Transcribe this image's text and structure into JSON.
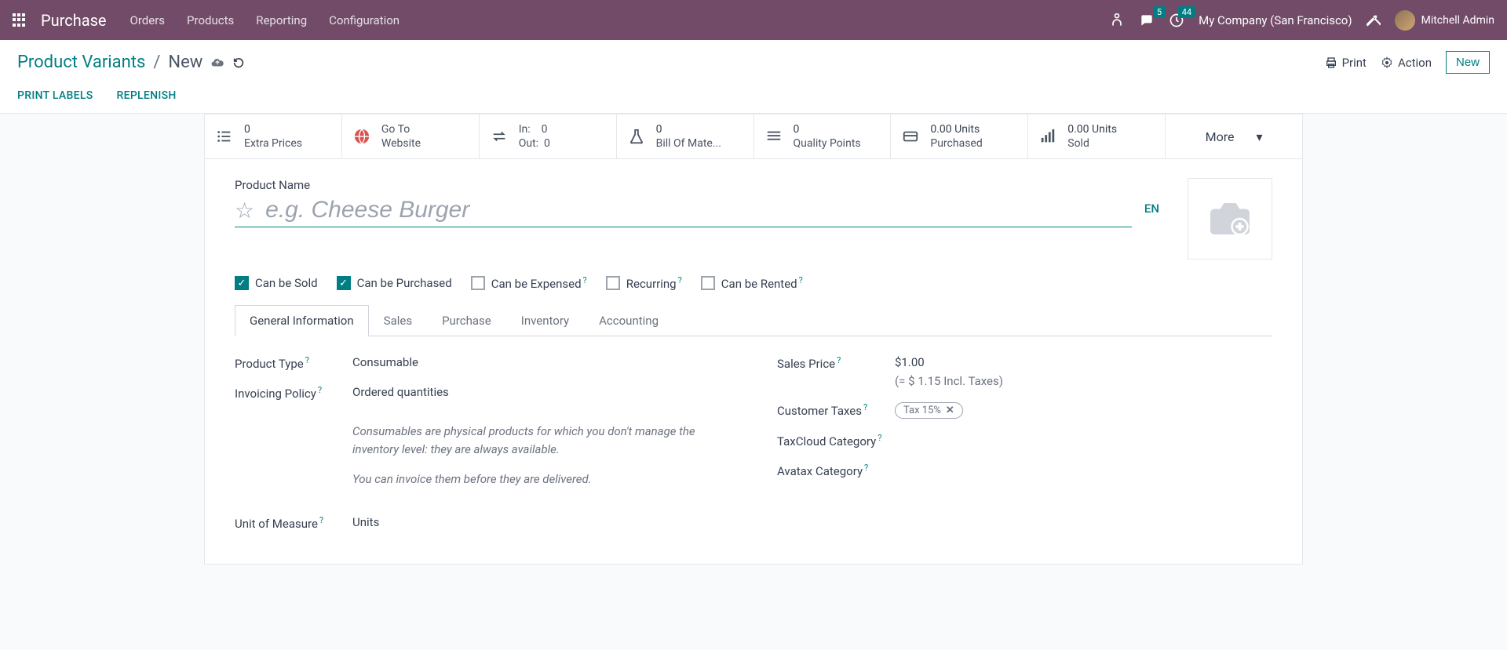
{
  "topbar": {
    "brand": "Purchase",
    "menu": [
      "Orders",
      "Products",
      "Reporting",
      "Configuration"
    ],
    "msg_count": "5",
    "activity_count": "44",
    "company": "My Company (San Francisco)",
    "user": "Mitchell Admin"
  },
  "breadcrumb": {
    "parent": "Product Variants",
    "current": "New"
  },
  "actions": {
    "print": "Print",
    "action": "Action",
    "new": "New"
  },
  "secondary": {
    "print_labels": "PRINT LABELS",
    "replenish": "REPLENISH"
  },
  "stats": {
    "extra_prices": {
      "val": "0",
      "label": "Extra Prices"
    },
    "website": {
      "line1": "Go To",
      "line2": "Website"
    },
    "inout": {
      "in_label": "In:",
      "in_val": "0",
      "out_label": "Out:",
      "out_val": "0"
    },
    "bom": {
      "val": "0",
      "label": "Bill Of Mate..."
    },
    "quality": {
      "val": "0",
      "label": "Quality Points"
    },
    "purchased": {
      "val": "0.00 Units",
      "label": "Purchased"
    },
    "sold": {
      "val": "0.00 Units",
      "label": "Sold"
    },
    "more": "More"
  },
  "product": {
    "name_label": "Product Name",
    "name_placeholder": "e.g. Cheese Burger",
    "name_value": "",
    "lang": "EN"
  },
  "checks": {
    "sold": "Can be Sold",
    "purchased": "Can be Purchased",
    "expensed": "Can be Expensed",
    "recurring": "Recurring",
    "rented": "Can be Rented"
  },
  "tabs": [
    "General Information",
    "Sales",
    "Purchase",
    "Inventory",
    "Accounting"
  ],
  "fields": {
    "product_type": {
      "label": "Product Type",
      "value": "Consumable"
    },
    "invoicing_policy": {
      "label": "Invoicing Policy",
      "value": "Ordered quantities"
    },
    "help1": "Consumables are physical products for which you don't manage the inventory level: they are always available.",
    "help2": "You can invoice them before they are delivered.",
    "uom": {
      "label": "Unit of Measure",
      "value": "Units"
    },
    "sales_price": {
      "label": "Sales Price",
      "value": "$1.00",
      "incl": "(= $ 1.15 Incl. Taxes)"
    },
    "customer_taxes": {
      "label": "Customer Taxes",
      "tag": "Tax 15%"
    },
    "taxcloud": {
      "label": "TaxCloud Category"
    },
    "avatax": {
      "label": "Avatax Category"
    }
  }
}
